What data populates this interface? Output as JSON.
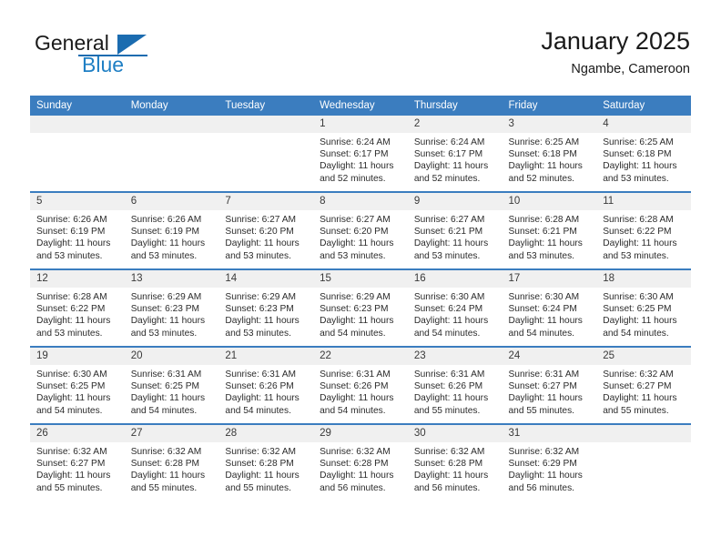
{
  "brand": {
    "word1": "General",
    "word2": "Blue",
    "logo_icon": "triangle-logo-icon",
    "accent_color": "#1b6cb0"
  },
  "header": {
    "title": "January 2025",
    "subtitle": "Ngambe, Cameroon"
  },
  "theme": {
    "header_blue": "#3b7dbf",
    "daynum_gray": "#f0f0f0"
  },
  "calendar": {
    "weekday_headers": [
      "Sunday",
      "Monday",
      "Tuesday",
      "Wednesday",
      "Thursday",
      "Friday",
      "Saturday"
    ],
    "weeks": [
      [
        {
          "day": "",
          "sunrise": "",
          "sunset": "",
          "daylight": ""
        },
        {
          "day": "",
          "sunrise": "",
          "sunset": "",
          "daylight": ""
        },
        {
          "day": "",
          "sunrise": "",
          "sunset": "",
          "daylight": ""
        },
        {
          "day": "1",
          "sunrise": "Sunrise: 6:24 AM",
          "sunset": "Sunset: 6:17 PM",
          "daylight": "Daylight: 11 hours and 52 minutes."
        },
        {
          "day": "2",
          "sunrise": "Sunrise: 6:24 AM",
          "sunset": "Sunset: 6:17 PM",
          "daylight": "Daylight: 11 hours and 52 minutes."
        },
        {
          "day": "3",
          "sunrise": "Sunrise: 6:25 AM",
          "sunset": "Sunset: 6:18 PM",
          "daylight": "Daylight: 11 hours and 52 minutes."
        },
        {
          "day": "4",
          "sunrise": "Sunrise: 6:25 AM",
          "sunset": "Sunset: 6:18 PM",
          "daylight": "Daylight: 11 hours and 53 minutes."
        }
      ],
      [
        {
          "day": "5",
          "sunrise": "Sunrise: 6:26 AM",
          "sunset": "Sunset: 6:19 PM",
          "daylight": "Daylight: 11 hours and 53 minutes."
        },
        {
          "day": "6",
          "sunrise": "Sunrise: 6:26 AM",
          "sunset": "Sunset: 6:19 PM",
          "daylight": "Daylight: 11 hours and 53 minutes."
        },
        {
          "day": "7",
          "sunrise": "Sunrise: 6:27 AM",
          "sunset": "Sunset: 6:20 PM",
          "daylight": "Daylight: 11 hours and 53 minutes."
        },
        {
          "day": "8",
          "sunrise": "Sunrise: 6:27 AM",
          "sunset": "Sunset: 6:20 PM",
          "daylight": "Daylight: 11 hours and 53 minutes."
        },
        {
          "day": "9",
          "sunrise": "Sunrise: 6:27 AM",
          "sunset": "Sunset: 6:21 PM",
          "daylight": "Daylight: 11 hours and 53 minutes."
        },
        {
          "day": "10",
          "sunrise": "Sunrise: 6:28 AM",
          "sunset": "Sunset: 6:21 PM",
          "daylight": "Daylight: 11 hours and 53 minutes."
        },
        {
          "day": "11",
          "sunrise": "Sunrise: 6:28 AM",
          "sunset": "Sunset: 6:22 PM",
          "daylight": "Daylight: 11 hours and 53 minutes."
        }
      ],
      [
        {
          "day": "12",
          "sunrise": "Sunrise: 6:28 AM",
          "sunset": "Sunset: 6:22 PM",
          "daylight": "Daylight: 11 hours and 53 minutes."
        },
        {
          "day": "13",
          "sunrise": "Sunrise: 6:29 AM",
          "sunset": "Sunset: 6:23 PM",
          "daylight": "Daylight: 11 hours and 53 minutes."
        },
        {
          "day": "14",
          "sunrise": "Sunrise: 6:29 AM",
          "sunset": "Sunset: 6:23 PM",
          "daylight": "Daylight: 11 hours and 53 minutes."
        },
        {
          "day": "15",
          "sunrise": "Sunrise: 6:29 AM",
          "sunset": "Sunset: 6:23 PM",
          "daylight": "Daylight: 11 hours and 54 minutes."
        },
        {
          "day": "16",
          "sunrise": "Sunrise: 6:30 AM",
          "sunset": "Sunset: 6:24 PM",
          "daylight": "Daylight: 11 hours and 54 minutes."
        },
        {
          "day": "17",
          "sunrise": "Sunrise: 6:30 AM",
          "sunset": "Sunset: 6:24 PM",
          "daylight": "Daylight: 11 hours and 54 minutes."
        },
        {
          "day": "18",
          "sunrise": "Sunrise: 6:30 AM",
          "sunset": "Sunset: 6:25 PM",
          "daylight": "Daylight: 11 hours and 54 minutes."
        }
      ],
      [
        {
          "day": "19",
          "sunrise": "Sunrise: 6:30 AM",
          "sunset": "Sunset: 6:25 PM",
          "daylight": "Daylight: 11 hours and 54 minutes."
        },
        {
          "day": "20",
          "sunrise": "Sunrise: 6:31 AM",
          "sunset": "Sunset: 6:25 PM",
          "daylight": "Daylight: 11 hours and 54 minutes."
        },
        {
          "day": "21",
          "sunrise": "Sunrise: 6:31 AM",
          "sunset": "Sunset: 6:26 PM",
          "daylight": "Daylight: 11 hours and 54 minutes."
        },
        {
          "day": "22",
          "sunrise": "Sunrise: 6:31 AM",
          "sunset": "Sunset: 6:26 PM",
          "daylight": "Daylight: 11 hours and 54 minutes."
        },
        {
          "day": "23",
          "sunrise": "Sunrise: 6:31 AM",
          "sunset": "Sunset: 6:26 PM",
          "daylight": "Daylight: 11 hours and 55 minutes."
        },
        {
          "day": "24",
          "sunrise": "Sunrise: 6:31 AM",
          "sunset": "Sunset: 6:27 PM",
          "daylight": "Daylight: 11 hours and 55 minutes."
        },
        {
          "day": "25",
          "sunrise": "Sunrise: 6:32 AM",
          "sunset": "Sunset: 6:27 PM",
          "daylight": "Daylight: 11 hours and 55 minutes."
        }
      ],
      [
        {
          "day": "26",
          "sunrise": "Sunrise: 6:32 AM",
          "sunset": "Sunset: 6:27 PM",
          "daylight": "Daylight: 11 hours and 55 minutes."
        },
        {
          "day": "27",
          "sunrise": "Sunrise: 6:32 AM",
          "sunset": "Sunset: 6:28 PM",
          "daylight": "Daylight: 11 hours and 55 minutes."
        },
        {
          "day": "28",
          "sunrise": "Sunrise: 6:32 AM",
          "sunset": "Sunset: 6:28 PM",
          "daylight": "Daylight: 11 hours and 55 minutes."
        },
        {
          "day": "29",
          "sunrise": "Sunrise: 6:32 AM",
          "sunset": "Sunset: 6:28 PM",
          "daylight": "Daylight: 11 hours and 56 minutes."
        },
        {
          "day": "30",
          "sunrise": "Sunrise: 6:32 AM",
          "sunset": "Sunset: 6:28 PM",
          "daylight": "Daylight: 11 hours and 56 minutes."
        },
        {
          "day": "31",
          "sunrise": "Sunrise: 6:32 AM",
          "sunset": "Sunset: 6:29 PM",
          "daylight": "Daylight: 11 hours and 56 minutes."
        },
        {
          "day": "",
          "sunrise": "",
          "sunset": "",
          "daylight": ""
        }
      ]
    ]
  }
}
